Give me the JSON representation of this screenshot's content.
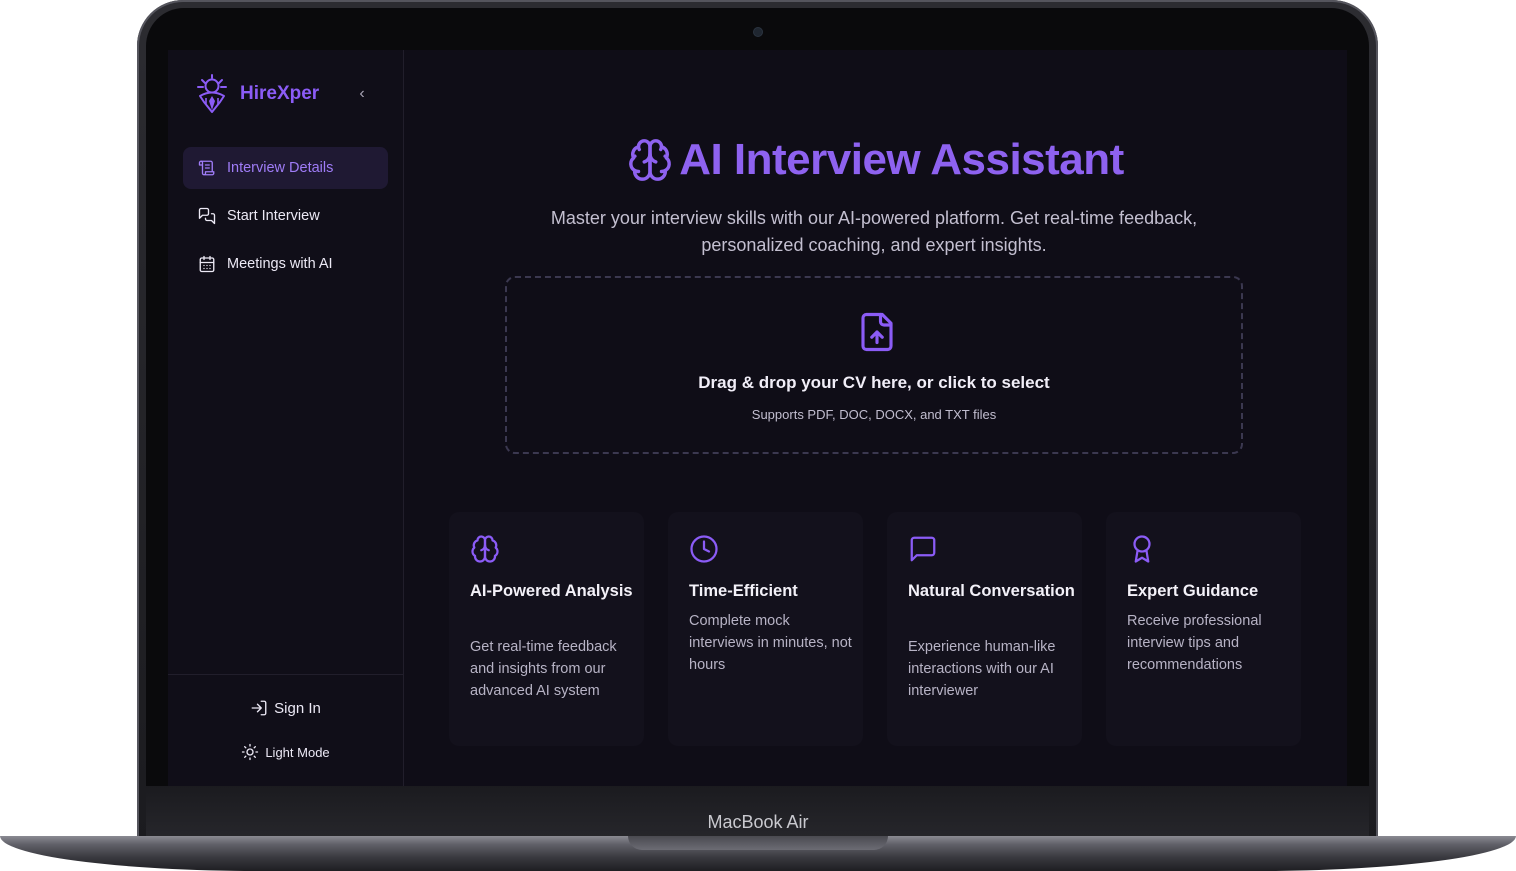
{
  "device": {
    "label": "MacBook Air"
  },
  "sidebar": {
    "brand": "HireXper",
    "collapse_icon": "‹",
    "items": [
      {
        "label": "Interview Details",
        "icon": "scroll-icon",
        "active": true
      },
      {
        "label": "Start Interview",
        "icon": "chat-bubbles-icon",
        "active": false
      },
      {
        "label": "Meetings with AI",
        "icon": "calendar-icon",
        "active": false
      }
    ],
    "footer": {
      "sign_in": "Sign In",
      "theme_toggle": "Light Mode"
    }
  },
  "hero": {
    "title": "AI Interview Assistant",
    "subtitle": "Master your interview skills with our AI-powered platform. Get real-time feedback, personalized coaching, and expert insights."
  },
  "upload": {
    "title": "Drag & drop your CV here, or click to select",
    "hint": "Supports PDF, DOC, DOCX, and TXT files"
  },
  "features": [
    {
      "icon": "brain-icon",
      "title": "AI-Powered Analysis",
      "description": "Get real-time feedback and insights from our advanced AI system"
    },
    {
      "icon": "clock-icon",
      "title": "Time-Efficient",
      "description": "Complete mock interviews in minutes, not hours"
    },
    {
      "icon": "message-square-icon",
      "title": "Natural Conversation",
      "description": "Experience human-like interactions with our AI interviewer"
    },
    {
      "icon": "award-icon",
      "title": "Expert Guidance",
      "description": "Receive professional interview tips and recommendations"
    }
  ],
  "colors": {
    "accent": "#8b5cf6",
    "background": "#0f0d17",
    "sidebar_active_bg": "#1f1933"
  }
}
